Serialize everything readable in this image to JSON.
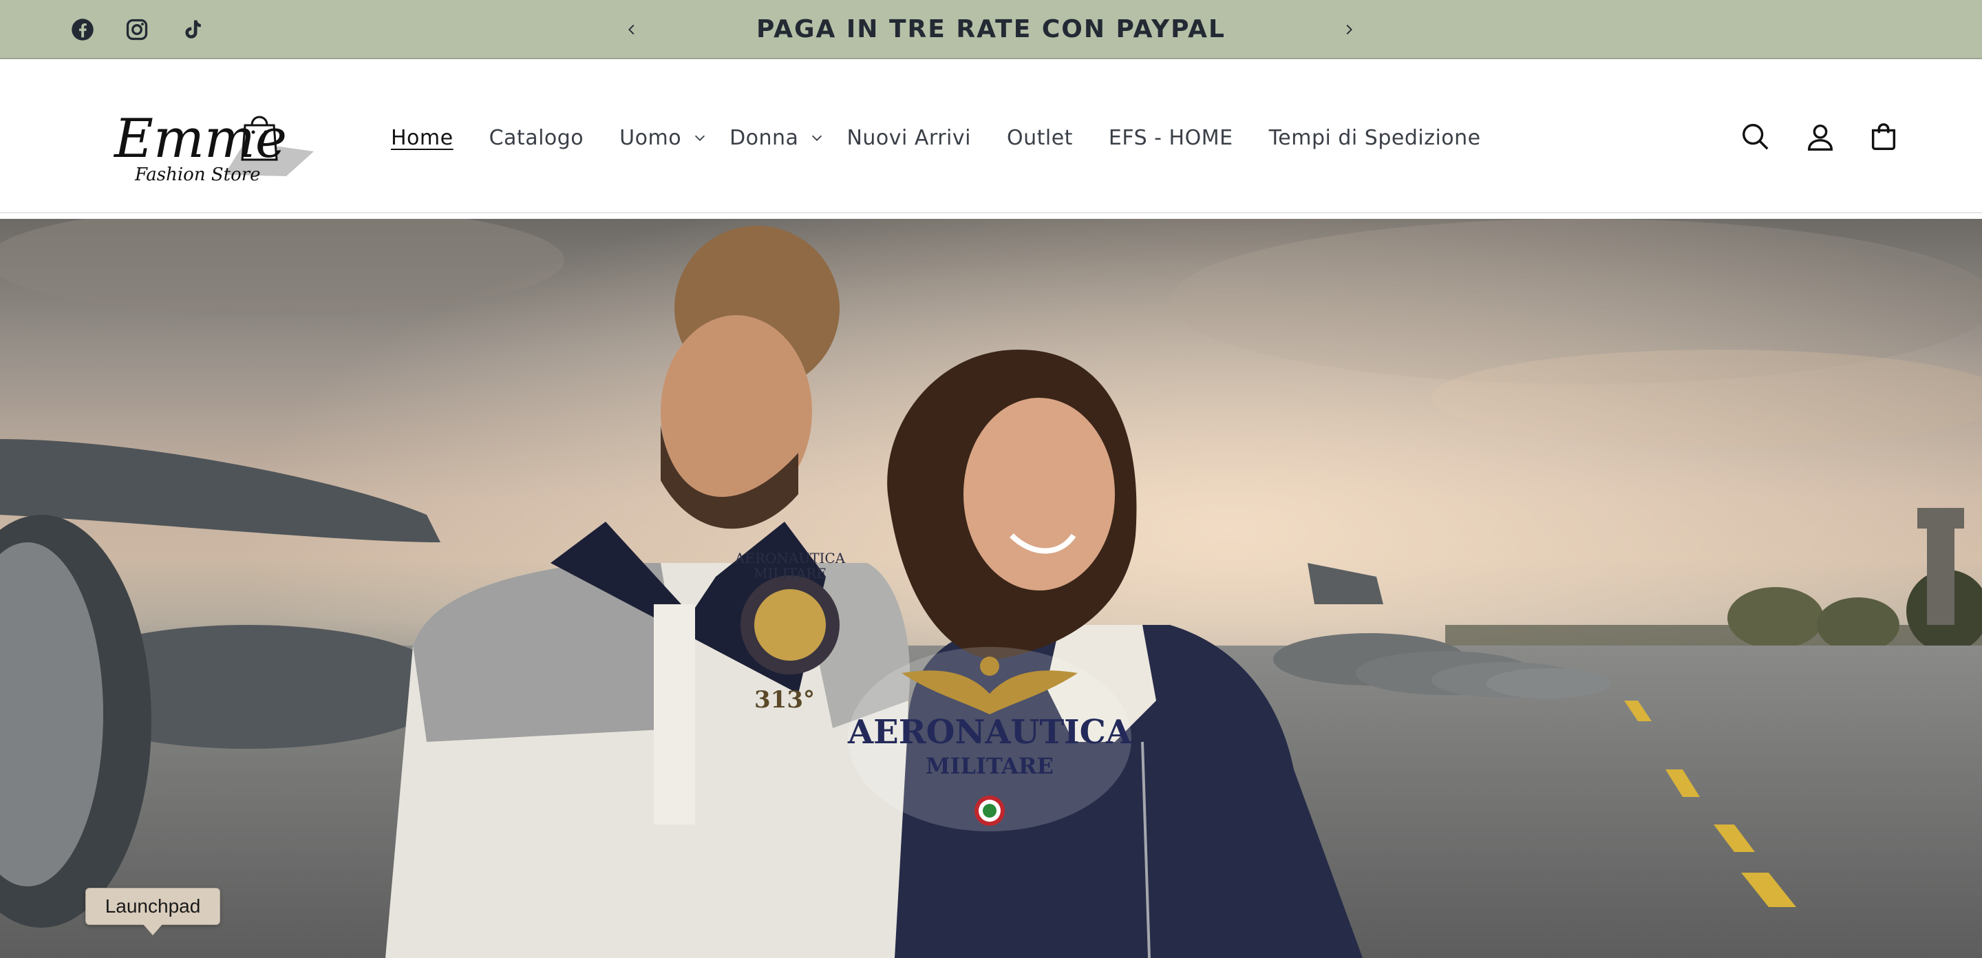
{
  "announcement": {
    "text": "PAGA IN TRE RATE CON PAYPAL",
    "prev_icon": "chevron-left-icon",
    "next_icon": "chevron-right-icon"
  },
  "social": [
    {
      "name": "facebook-icon"
    },
    {
      "name": "instagram-icon"
    },
    {
      "name": "tiktok-icon"
    }
  ],
  "logo": {
    "line1": "Emme",
    "line2": "Fashion Store"
  },
  "nav": {
    "items": [
      {
        "label": "Home",
        "active": true
      },
      {
        "label": "Catalogo"
      },
      {
        "label": "Uomo",
        "dropdown": true
      },
      {
        "label": "Donna",
        "dropdown": true
      },
      {
        "label": "Nuovi Arrivi"
      },
      {
        "label": "Outlet"
      },
      {
        "label": "EFS - HOME"
      },
      {
        "label": "Tempi di Spedizione"
      }
    ]
  },
  "header_icons": [
    "search-icon",
    "account-icon",
    "cart-icon"
  ],
  "hero": {
    "badge_line1": "AERONAUTICA",
    "badge_line2": "MILITARE",
    "polo_text1": "AERONAUTICA",
    "polo_text2": "MILITARE",
    "polo_text3": "313°"
  },
  "tooltip": {
    "text": "Launchpad"
  },
  "colors": {
    "announcement_bg": "#b5c0a7",
    "text_dark": "#232a34",
    "navy": "#1f2440"
  }
}
